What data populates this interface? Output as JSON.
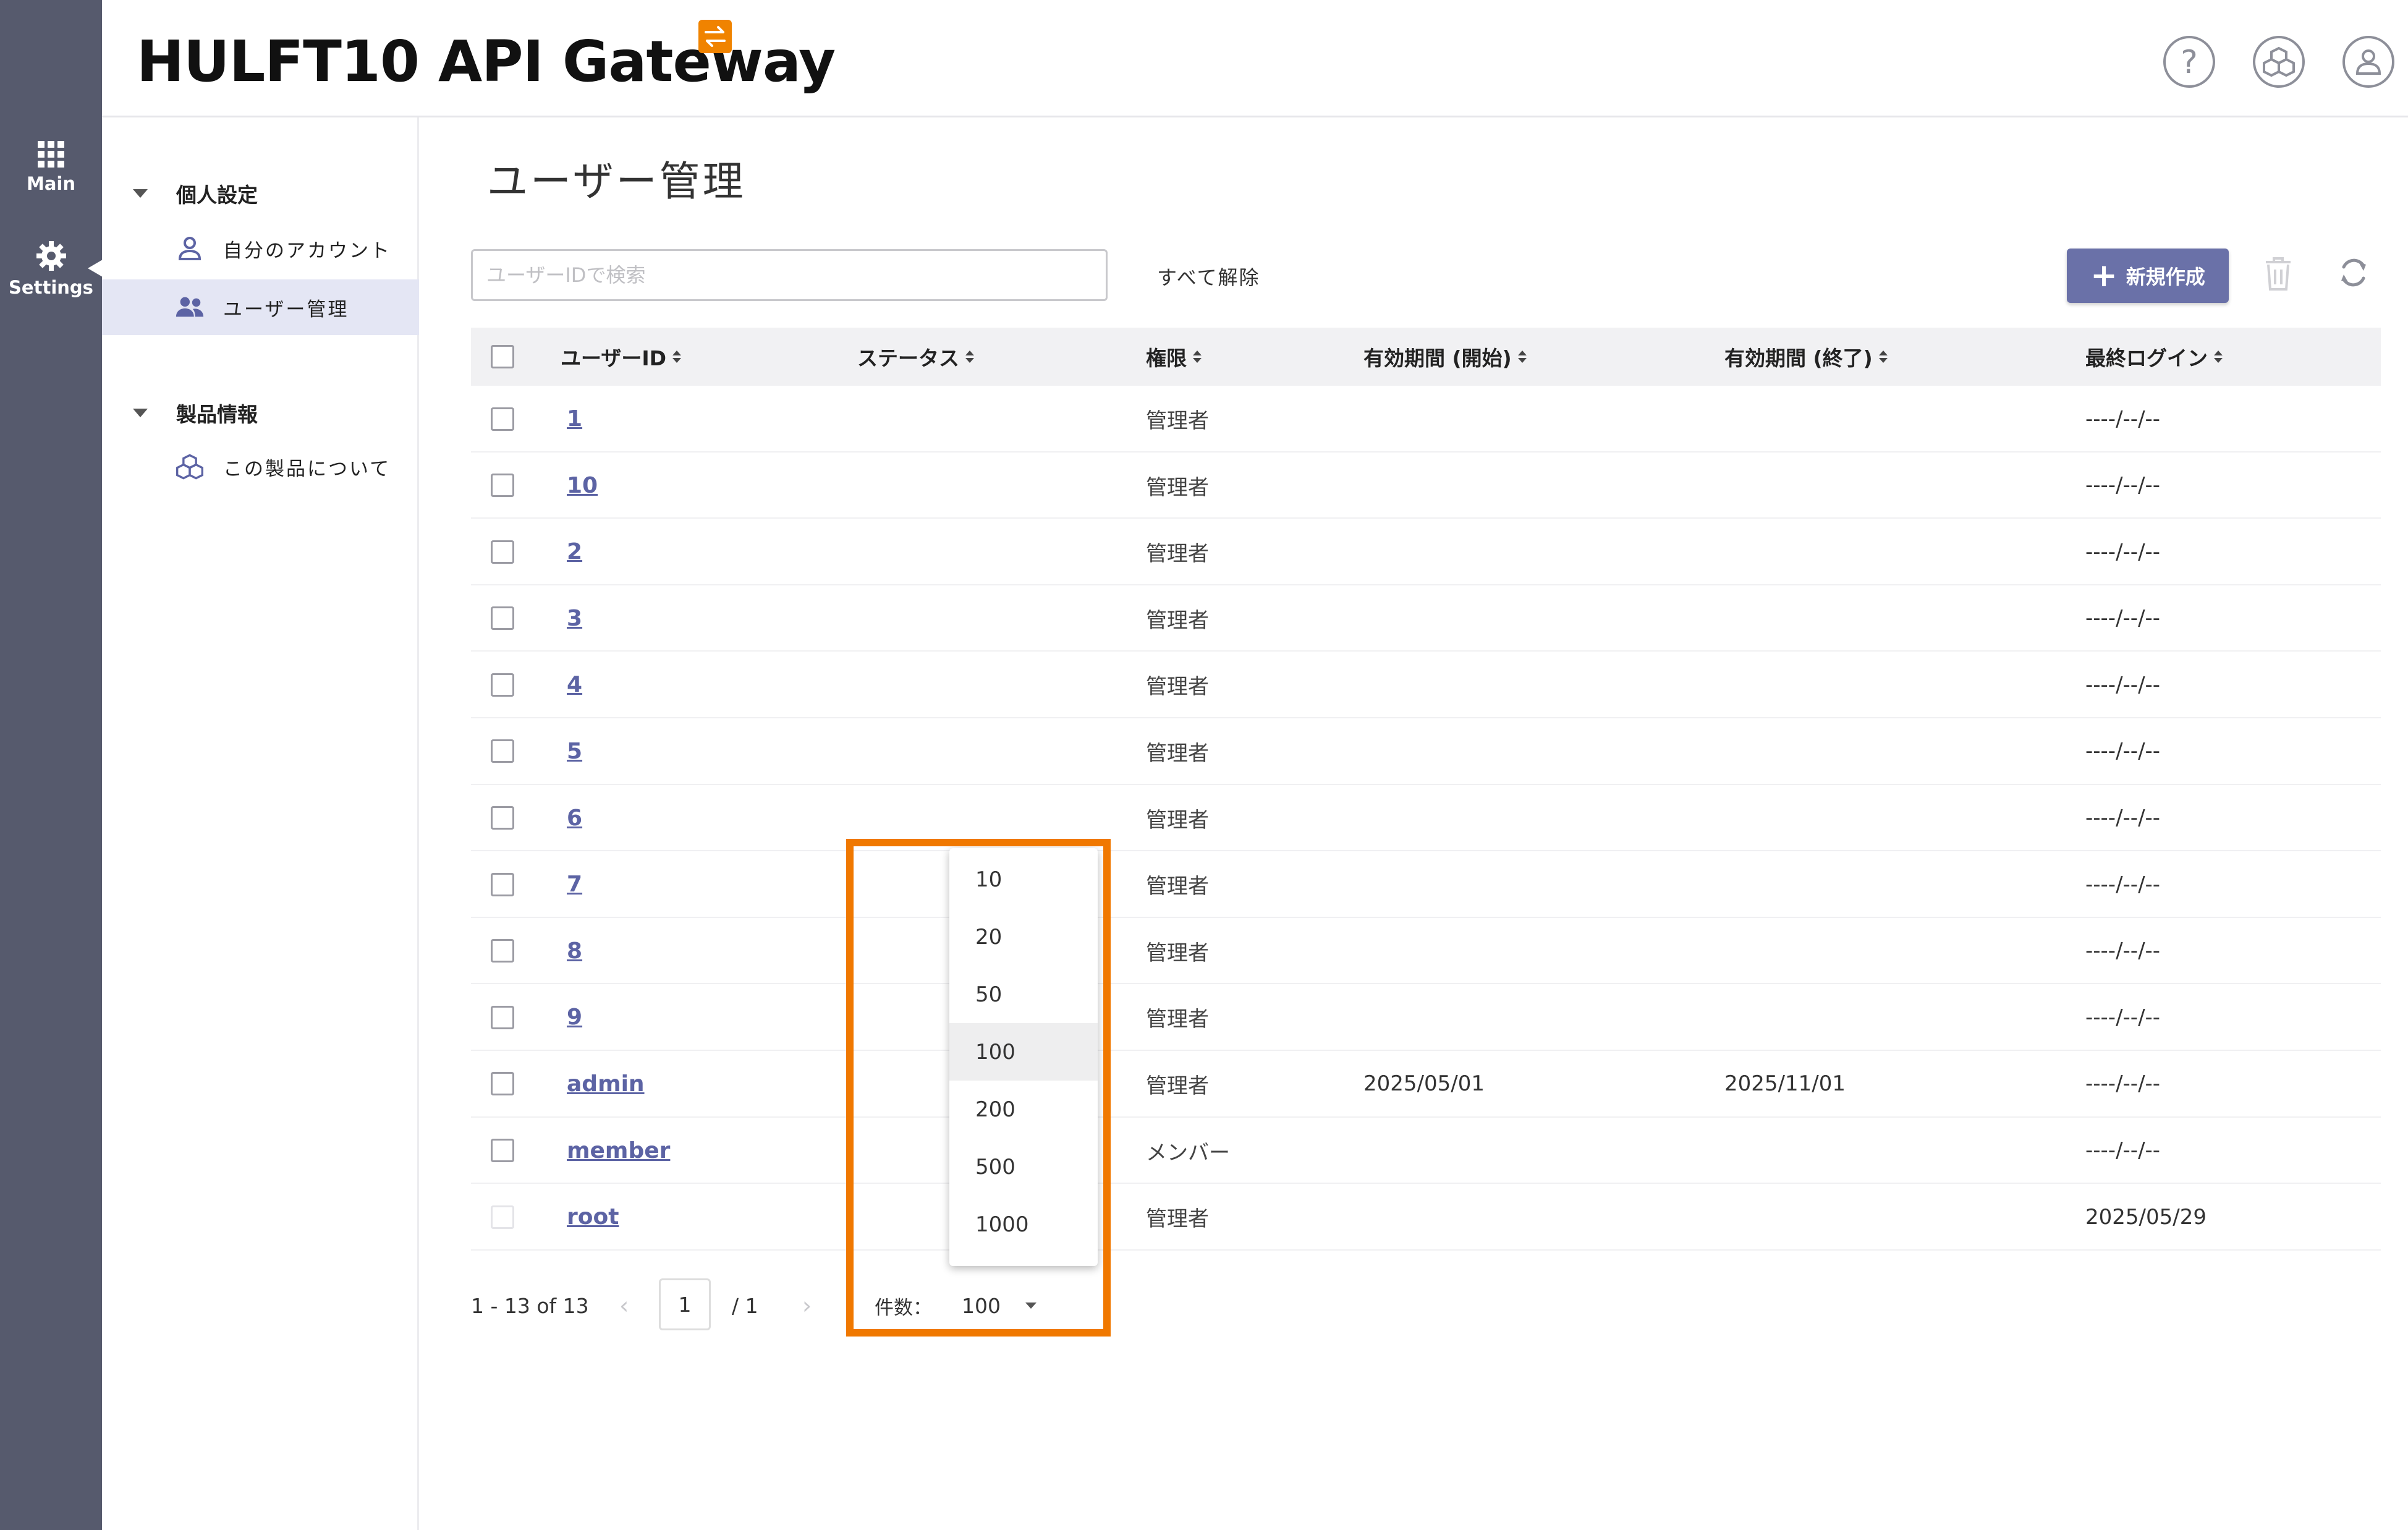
{
  "app": {
    "brand": "HULFT10 API Gateway",
    "rail": {
      "main_label": "Main",
      "settings_label": "Settings"
    }
  },
  "sidebar": {
    "groups": [
      {
        "label": "個人設定",
        "items": [
          {
            "label": "自分のアカウント",
            "icon": "user-icon"
          },
          {
            "label": "ユーザー管理",
            "icon": "users-icon",
            "active": true
          }
        ]
      },
      {
        "label": "製品情報",
        "items": [
          {
            "label": "この製品について",
            "icon": "cubes-icon"
          }
        ]
      }
    ]
  },
  "main": {
    "title": "ユーザー管理",
    "search": {
      "placeholder": "ユーザーIDで検索",
      "value": ""
    },
    "clear_all": "すべて解除",
    "new_button": "新規作成"
  },
  "table": {
    "columns": [
      "ユーザーID",
      "ステータス",
      "権限",
      "有効期間 (開始)",
      "有効期間 (終了)",
      "最終ログイン"
    ],
    "rows": [
      {
        "id": "1",
        "status": "",
        "role": "管理者",
        "start": "",
        "end": "",
        "last_login": "----/--/--"
      },
      {
        "id": "10",
        "status": "",
        "role": "管理者",
        "start": "",
        "end": "",
        "last_login": "----/--/--"
      },
      {
        "id": "2",
        "status": "",
        "role": "管理者",
        "start": "",
        "end": "",
        "last_login": "----/--/--"
      },
      {
        "id": "3",
        "status": "",
        "role": "管理者",
        "start": "",
        "end": "",
        "last_login": "----/--/--"
      },
      {
        "id": "4",
        "status": "",
        "role": "管理者",
        "start": "",
        "end": "",
        "last_login": "----/--/--"
      },
      {
        "id": "5",
        "status": "",
        "role": "管理者",
        "start": "",
        "end": "",
        "last_login": "----/--/--"
      },
      {
        "id": "6",
        "status": "",
        "role": "管理者",
        "start": "",
        "end": "",
        "last_login": "----/--/--"
      },
      {
        "id": "7",
        "status": "",
        "role": "管理者",
        "start": "",
        "end": "",
        "last_login": "----/--/--"
      },
      {
        "id": "8",
        "status": "",
        "role": "管理者",
        "start": "",
        "end": "",
        "last_login": "----/--/--"
      },
      {
        "id": "9",
        "status": "",
        "role": "管理者",
        "start": "",
        "end": "",
        "last_login": "----/--/--"
      },
      {
        "id": "admin",
        "status": "",
        "role": "管理者",
        "start": "2025/05/01",
        "end": "2025/11/01",
        "last_login": "----/--/--"
      },
      {
        "id": "member",
        "status": "",
        "role": "メンバー",
        "start": "",
        "end": "",
        "last_login": "----/--/--"
      },
      {
        "id": "root",
        "status": "",
        "role": "管理者",
        "start": "",
        "end": "",
        "last_login": "2025/05/29"
      }
    ]
  },
  "pagination": {
    "range": "1 - 13 of 13",
    "page": "1",
    "total_pages": "/ 1",
    "per_page_label": "件数：",
    "per_page_value": "100",
    "options": [
      "10",
      "20",
      "50",
      "100",
      "200",
      "500",
      "1000"
    ]
  },
  "colors": {
    "rail": "#565a6d",
    "accent": "#6a71a8",
    "highlight": "#f07800",
    "brand_badge": "#f08300"
  }
}
